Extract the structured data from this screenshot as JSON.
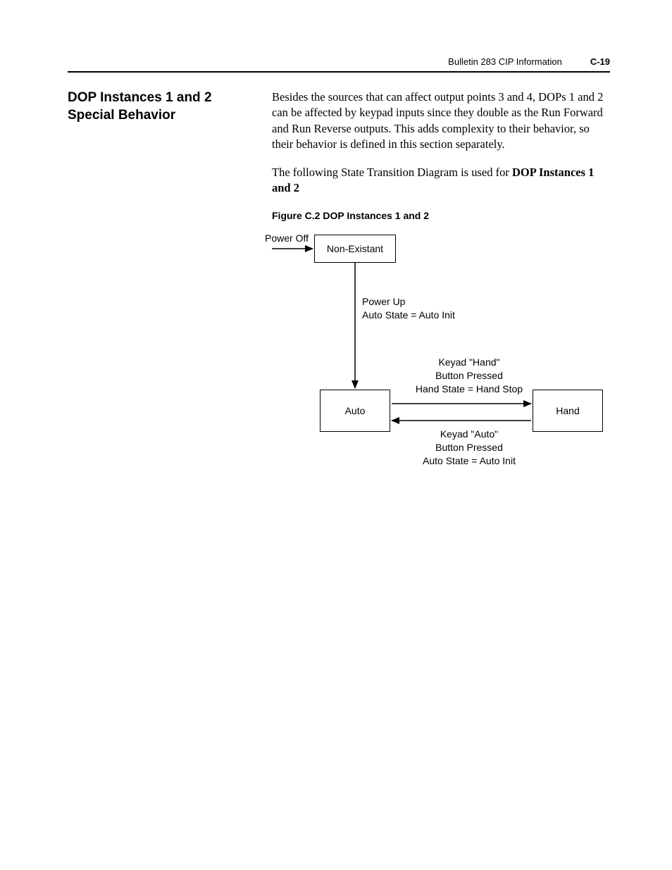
{
  "header": {
    "running_title": "Bulletin 283 CIP Information",
    "page_number": "C-19"
  },
  "section": {
    "heading": "DOP Instances 1 and 2 Special Behavior",
    "paragraph1": "Besides the sources that can affect output points 3 and 4, DOPs 1 and 2 can be affected by keypad inputs since they double as the Run Forward and Run Reverse outputs. This adds complexity to their behavior, so their behavior is defined in this section separately.",
    "paragraph2_lead": "The following State Transition Diagram is used for ",
    "paragraph2_bold": "DOP Instances 1 and 2"
  },
  "figure": {
    "caption": "Figure C.2   DOP Instances 1 and 2",
    "labels": {
      "power_off": "Power Off",
      "non_existant": "Non-Existant",
      "power_up_line1": "Power Up",
      "power_up_line2": "Auto State = Auto Init",
      "auto": "Auto",
      "hand": "Hand",
      "to_hand_line1": "Keyad  \"Hand\"",
      "to_hand_line2": "Button Pressed",
      "to_hand_line3": "Hand State = Hand Stop",
      "to_auto_line1": "Keyad  \"Auto\"",
      "to_auto_line2": "Button Pressed",
      "to_auto_line3": "Auto State = Auto Init"
    }
  }
}
